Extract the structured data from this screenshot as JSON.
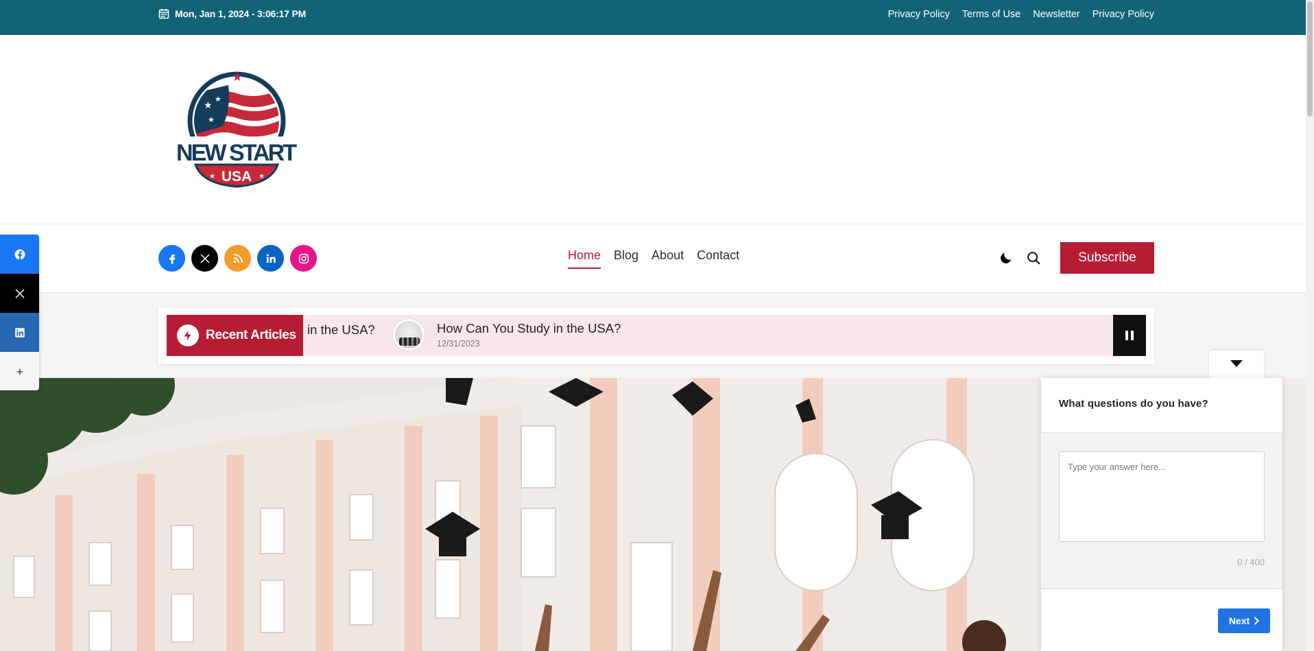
{
  "topbar": {
    "date": "Mon, Jan 1, 2024 - 3:06:17 PM",
    "links": [
      "Privacy Policy",
      "Terms of Use",
      "Newsletter",
      "Privacy Policy"
    ],
    "bg_color": "#136376"
  },
  "logo": {
    "line1": "NEW START",
    "line2": "USA"
  },
  "nav": {
    "socials": [
      {
        "name": "facebook",
        "color": "#1877f2"
      },
      {
        "name": "x",
        "color": "#000000"
      },
      {
        "name": "rss",
        "color": "#f39c2a"
      },
      {
        "name": "linkedin",
        "color": "#0a66c2"
      },
      {
        "name": "instagram",
        "color": "#e4168a"
      }
    ],
    "menu": [
      "Home",
      "Blog",
      "About",
      "Contact"
    ],
    "active": "Home",
    "subscribe_label": "Subscribe",
    "accent_color": "#b71c35"
  },
  "ticker": {
    "label": "Recent Articles",
    "trail_text": "in the USA?",
    "item": {
      "title": "How Can You Study in the USA?",
      "date": "12/31/2023"
    }
  },
  "share_bar": [
    {
      "name": "facebook",
      "color": "#1877f2"
    },
    {
      "name": "x",
      "color": "#000000"
    },
    {
      "name": "linkedin",
      "color": "#2867b2"
    },
    {
      "name": "more",
      "color": "#f5f5f5"
    }
  ],
  "feedback": {
    "question": "What questions do you have?",
    "placeholder": "Type your answer here...",
    "counter": "0 / 400",
    "next_label": "Next"
  }
}
